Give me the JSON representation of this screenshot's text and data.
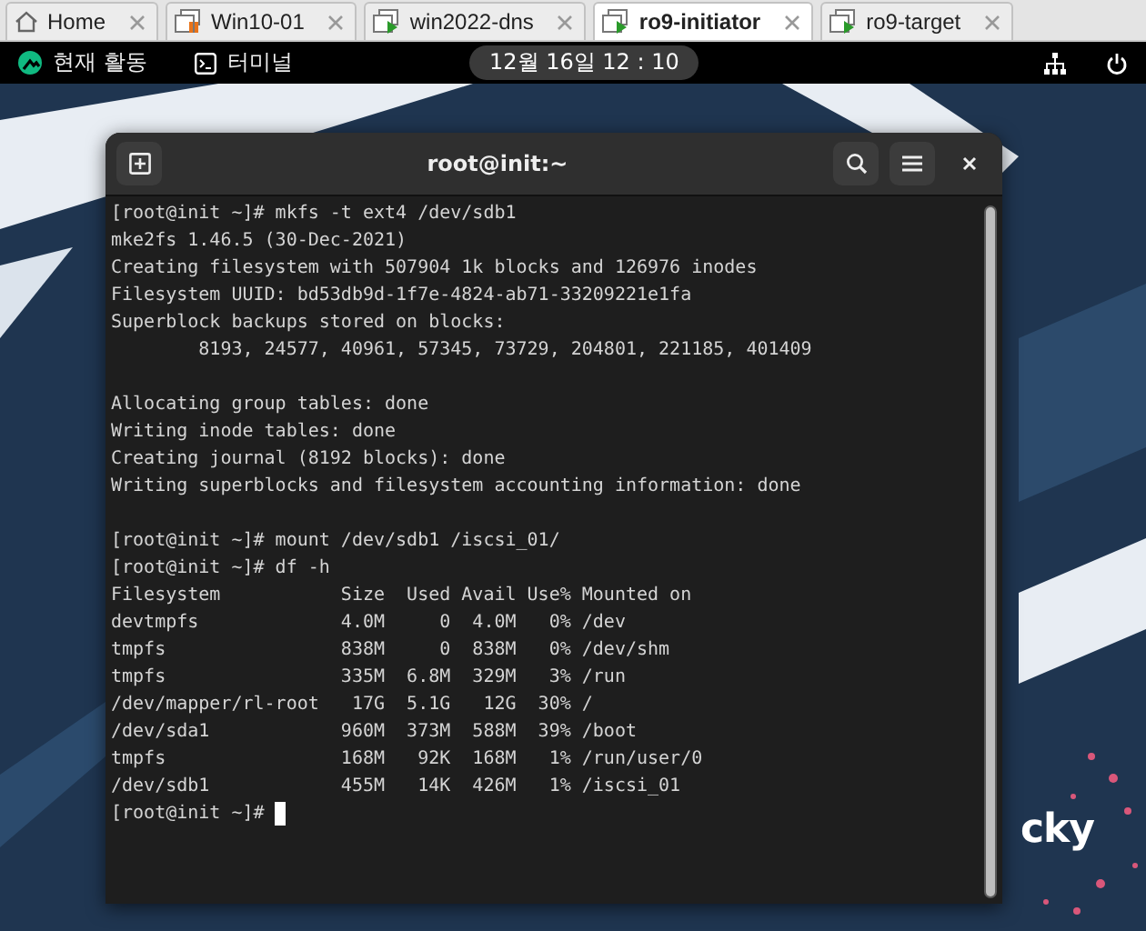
{
  "vm_tabs": [
    {
      "label": "Home",
      "kind": "home",
      "selected": false
    },
    {
      "label": "Win10-01",
      "kind": "vm",
      "paused": true,
      "selected": false
    },
    {
      "label": "win2022-dns",
      "kind": "vm",
      "paused": false,
      "selected": false
    },
    {
      "label": "ro9-initiator",
      "kind": "vm",
      "paused": false,
      "selected": true
    },
    {
      "label": "ro9-target",
      "kind": "vm",
      "paused": false,
      "selected": false
    }
  ],
  "top_bar": {
    "activities": "현재 활동",
    "app": "터미널",
    "clock": "12월 16일 12 : 10"
  },
  "terminal": {
    "title": "root@init:~",
    "blocks": [
      [
        "[root@init ~]# mkfs -t ext4 /dev/sdb1",
        "mke2fs 1.46.5 (30-Dec-2021)",
        "Creating filesystem with 507904 1k blocks and 126976 inodes",
        "Filesystem UUID: bd53db9d-1f7e-4824-ab71-33209221e1fa",
        "Superblock backups stored on blocks:",
        "        8193, 24577, 40961, 57345, 73729, 204801, 221185, 401409"
      ],
      [
        "Allocating group tables: done",
        "Writing inode tables: done",
        "Creating journal (8192 blocks): done",
        "Writing superblocks and filesystem accounting information: done"
      ],
      [
        "[root@init ~]# mount /dev/sdb1 /iscsi_01/",
        "[root@init ~]# df -h",
        "Filesystem           Size  Used Avail Use% Mounted on",
        "devtmpfs             4.0M     0  4.0M   0% /dev",
        "tmpfs                838M     0  838M   0% /dev/shm",
        "tmpfs                335M  6.8M  329M   3% /run",
        "/dev/mapper/rl-root   17G  5.1G   12G  30% /",
        "/dev/sda1            960M  373M  588M  39% /boot",
        "tmpfs                168M   92K  168M   1% /run/user/0",
        "/dev/sdb1            455M   14K  426M   1% /iscsi_01"
      ]
    ],
    "prompt": "[root@init ~]#"
  },
  "wallpaper_logo_text": "cky"
}
